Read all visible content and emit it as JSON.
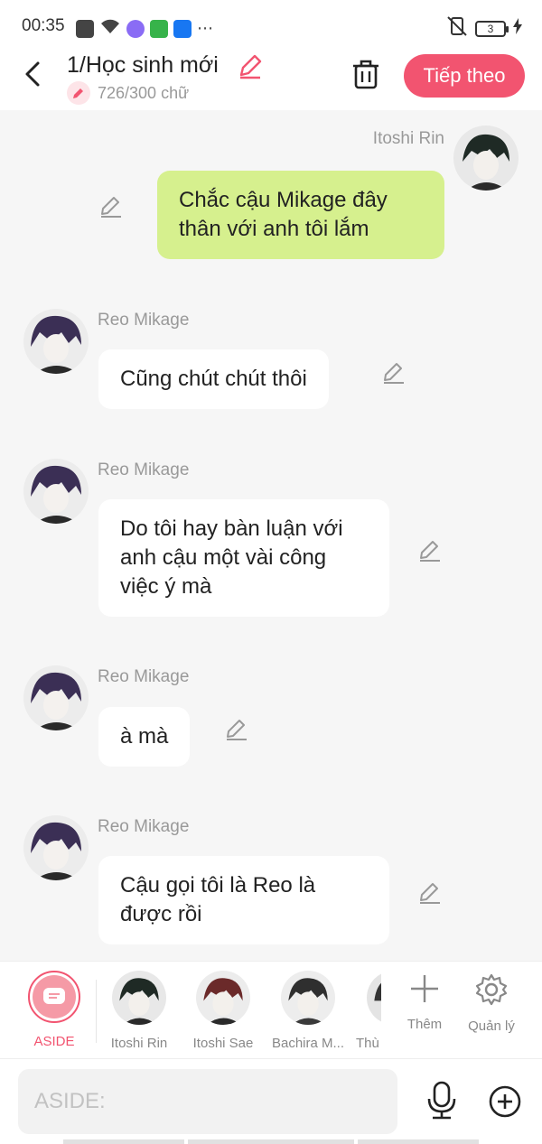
{
  "status_bar": {
    "time": "00:35",
    "battery": "3"
  },
  "header": {
    "title": "1/Học sinh mới",
    "word_count": "726/300 chữ",
    "next_label": "Tiếp theo"
  },
  "messages": [
    {
      "side": "right",
      "sender": "Itoshi Rin",
      "text": "Chắc cậu Mikage đây thân với anh tôi lắm"
    },
    {
      "side": "left",
      "sender": "Reo Mikage",
      "text": "Cũng chút chút thôi"
    },
    {
      "side": "left",
      "sender": "Reo Mikage",
      "text": "Do tôi hay bàn luận với anh cậu một vài công việc ý mà"
    },
    {
      "side": "left",
      "sender": "Reo Mikage",
      "text": "à mà"
    },
    {
      "side": "left",
      "sender": "Reo Mikage",
      "text": "Cậu gọi tôi là Reo là được rồi"
    }
  ],
  "characters": [
    {
      "label": "ASIDE",
      "selected": true
    },
    {
      "label": "Itoshi Rin"
    },
    {
      "label": "Itoshi Sae"
    },
    {
      "label": "Bachira M..."
    },
    {
      "label": "Thù"
    }
  ],
  "tools": {
    "add_label": "Thêm",
    "manage_label": "Quản lý"
  },
  "input": {
    "placeholder": "ASIDE:"
  },
  "colors": {
    "accent": "#f25470",
    "right_bubble": "#d6f08e",
    "background": "#f6f6f6"
  }
}
